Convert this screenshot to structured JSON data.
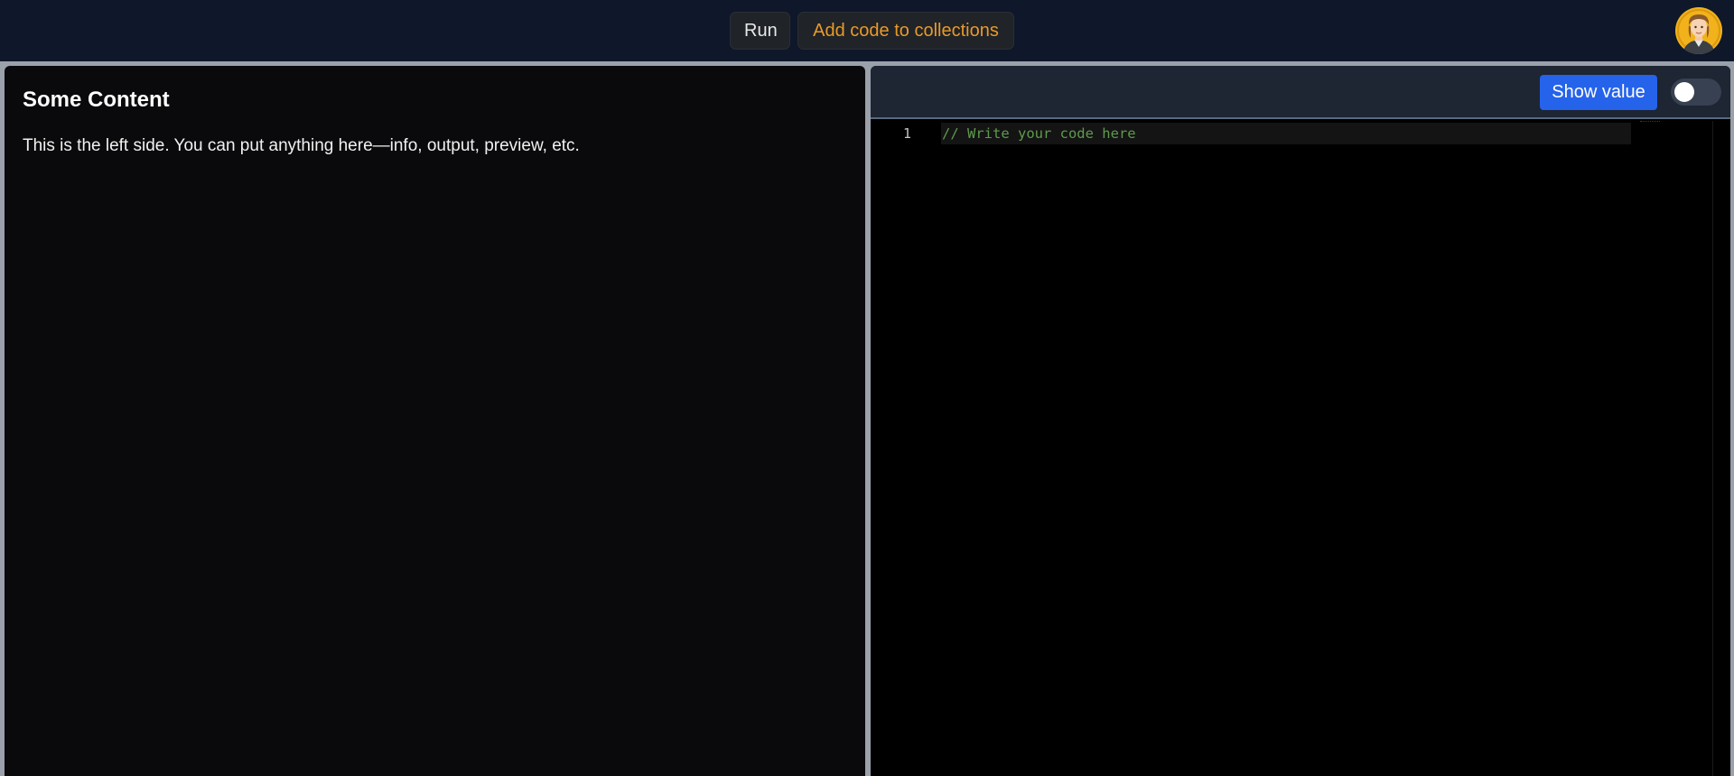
{
  "toolbar": {
    "run_label": "Run",
    "collections_label": "Add code to collections",
    "avatar_icon": "user-avatar-icon"
  },
  "left": {
    "title": "Some Content",
    "text": "This is the left side. You can put anything here—info, output, preview, etc."
  },
  "editor": {
    "show_value_label": "Show value",
    "toggle_on": false,
    "lines": [
      {
        "number": "1",
        "code": "// Write your code here"
      }
    ]
  },
  "colors": {
    "topbar": "#0f172a",
    "accent_orange": "#e89a2a",
    "primary_blue": "#2563eb",
    "comment_green": "#5f9a4d"
  }
}
